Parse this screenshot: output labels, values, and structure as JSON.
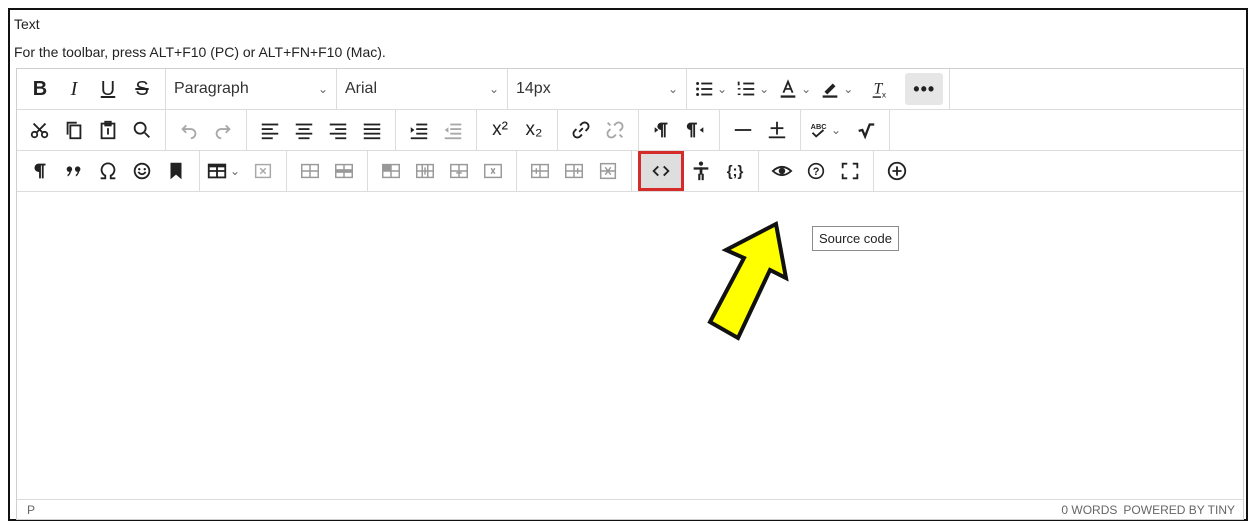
{
  "field": {
    "label": "Text",
    "hint": "For the toolbar, press ALT+F10 (PC) or ALT+FN+F10 (Mac)."
  },
  "toolbar": {
    "row1": {
      "bold": "B",
      "italic": "I",
      "underline": "U",
      "strike": "S",
      "block_format": "Paragraph",
      "font_family": "Arial",
      "font_size": "14px",
      "more": "•••"
    },
    "row2": {
      "superscript": "x²",
      "subscript": "x₂"
    },
    "row3": {
      "codesample": "{;}"
    }
  },
  "tooltip": "Source code",
  "status": {
    "path": "P",
    "words": "0 WORDS",
    "powered": "POWERED BY TINY"
  },
  "colors": {
    "highlight_border": "#d62b2b",
    "arrow_fill": "#ffff00",
    "arrow_stroke": "#111111"
  }
}
